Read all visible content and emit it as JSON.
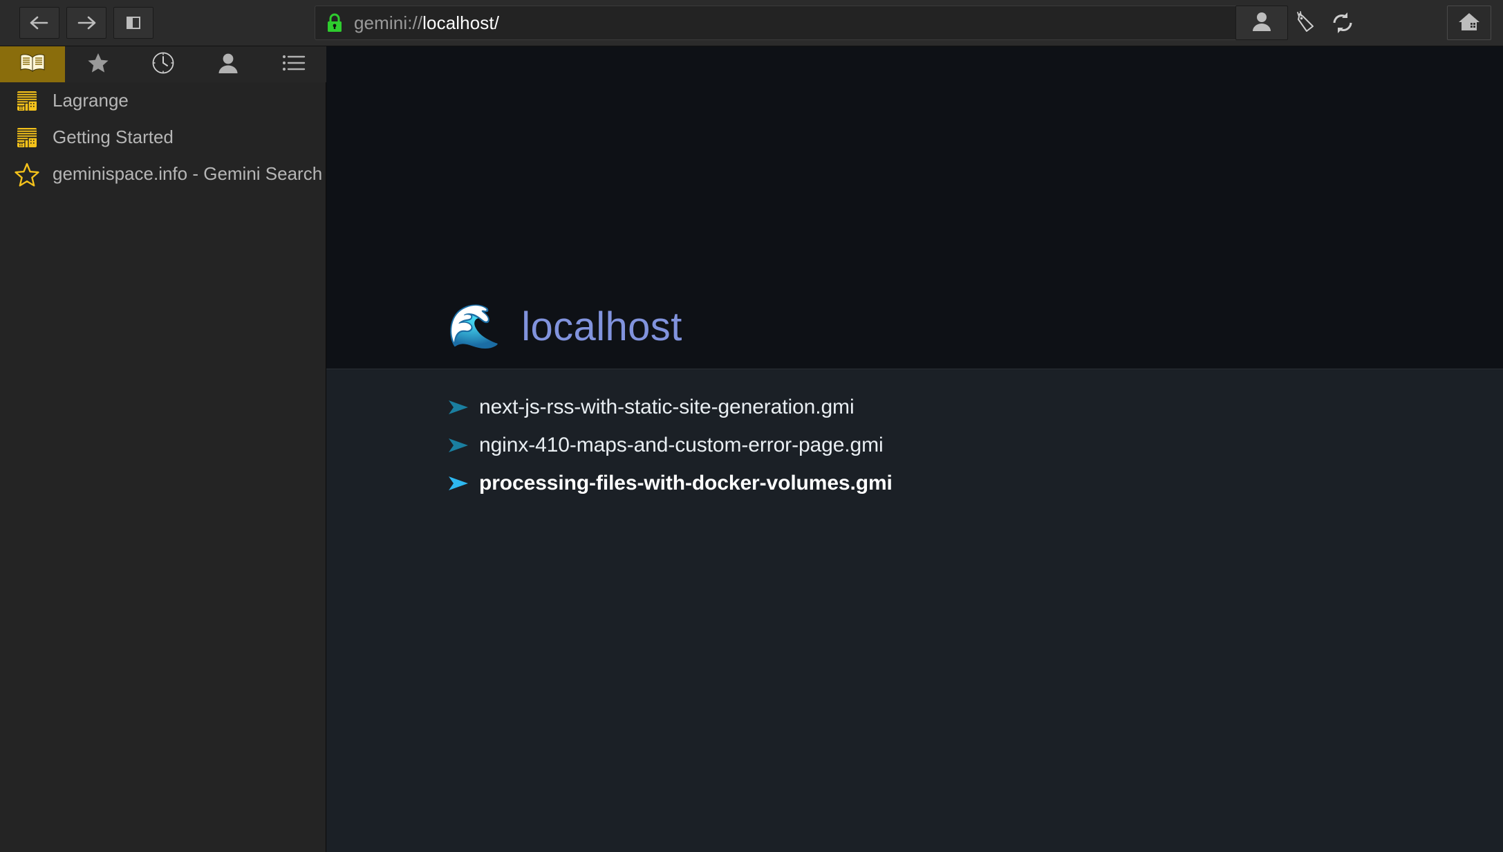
{
  "toolbar": {
    "back_icon": "arrow-left-icon",
    "forward_icon": "arrow-right-icon",
    "sidebar_toggle_icon": "sidebar-panel-icon",
    "lock_icon": "padlock-icon",
    "url_scheme": "gemini://",
    "url_rest": "localhost/",
    "url_full": "gemini://localhost/",
    "tag_icon": "bookmark-tag-icon",
    "reload_icon": "reload-icon",
    "identity_icon": "identity-person-icon",
    "home_icon": "home-icon"
  },
  "sidebar": {
    "tabs": [
      {
        "name": "bookmarks",
        "icon": "open-book-icon",
        "active": true
      },
      {
        "name": "feeds",
        "icon": "star-icon",
        "active": false
      },
      {
        "name": "history",
        "icon": "clock-icon",
        "active": false
      },
      {
        "name": "identities",
        "icon": "person-icon",
        "active": false
      },
      {
        "name": "outline",
        "icon": "list-icon",
        "active": false
      }
    ],
    "bookmarks": [
      {
        "icon": "page-document-icon",
        "label": "Lagrange"
      },
      {
        "icon": "page-document-icon",
        "label": "Getting Started"
      },
      {
        "icon": "star-outline-icon",
        "label": "geminispace.info - Gemini Search"
      }
    ]
  },
  "page": {
    "wave_icon": "🌊",
    "title": "localhost",
    "links": [
      {
        "label": "next-js-rss-with-static-site-generation.gmi",
        "hovered": false
      },
      {
        "label": "nginx-410-maps-and-custom-error-page.gmi",
        "hovered": false
      },
      {
        "label": "processing-files-with-docker-volumes.gmi",
        "hovered": true
      }
    ]
  },
  "colors": {
    "active_tab": "#8a6d0c",
    "bookmark_icon": "#f5c21b",
    "link_arrow": "#1a7fa0",
    "link_arrow_hover": "#2eb8f0",
    "site_title": "#8193dd",
    "lock_green": "#2ecc2e"
  }
}
